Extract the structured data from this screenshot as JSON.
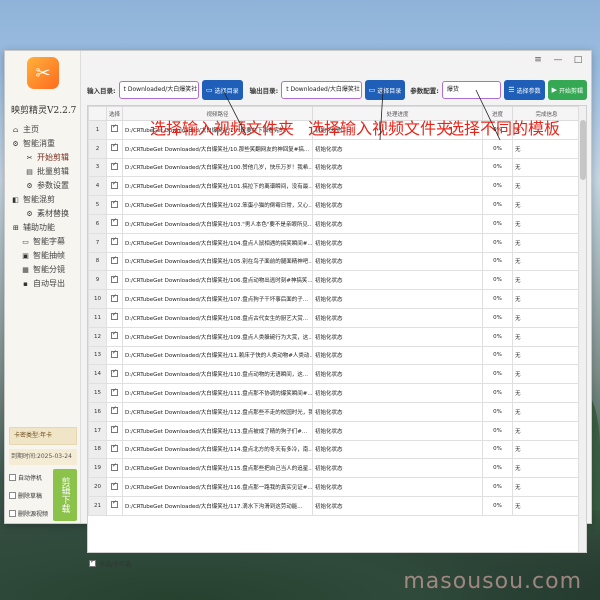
{
  "app": {
    "title": "映剪精灵V2.2.7"
  },
  "window_controls": [
    "≡",
    "—",
    "□"
  ],
  "sidebar": {
    "items": [
      {
        "label": "主页",
        "icon": "home-icon",
        "glyph": "⌂",
        "level": 0
      },
      {
        "label": "智能消重",
        "icon": "gear-icon",
        "glyph": "⚙",
        "level": 0
      },
      {
        "label": "开始剪辑",
        "icon": "scissors-icon",
        "glyph": "✂",
        "level": 1
      },
      {
        "label": "批量剪辑",
        "icon": "batch-icon",
        "glyph": "▤",
        "level": 1
      },
      {
        "label": "参数设置",
        "icon": "settings-icon",
        "glyph": "⚙",
        "level": 1
      },
      {
        "label": "智能混剪",
        "icon": "mix-icon",
        "glyph": "◧",
        "level": 0
      },
      {
        "label": "素材替换",
        "icon": "replace-icon",
        "glyph": "⚙",
        "level": 1
      },
      {
        "label": "辅助功能",
        "icon": "tools-icon",
        "glyph": "⊞",
        "level": 0
      },
      {
        "label": "智能字幕",
        "icon": "subtitle-icon",
        "glyph": "▭",
        "level": 2
      },
      {
        "label": "智能抽帧",
        "icon": "frame-icon",
        "glyph": "▣",
        "level": 2
      },
      {
        "label": "智能分镜",
        "icon": "storyboard-icon",
        "glyph": "▦",
        "level": 2
      },
      {
        "label": "自动导出",
        "icon": "export-icon",
        "glyph": "▪",
        "level": 2
      }
    ],
    "card_type": "卡密类型:年卡",
    "expire": "到期时间:2025-03-24",
    "options": [
      "自动停机",
      "删除草稿",
      "删除源视频"
    ],
    "cut_button": "剪辑下载"
  },
  "toolbar": {
    "input_label": "输入目录:",
    "input_value": "t Downloaded/大白爆笑社",
    "input_btn": "选择目录",
    "output_label": "输出目录:",
    "output_value": "t Downloaded/大白爆笑社",
    "output_btn": "选择目录",
    "param_label": "参数配置:",
    "param_value": "爆货",
    "param_btn": "选择参数",
    "start_btn": "开始剪辑"
  },
  "table": {
    "headers": [
      "",
      "选择",
      "视频路径",
      "处理进度",
      "进度",
      "完成信息"
    ],
    "rows": [
      {
        "n": "1",
        "path": "D:/CRTubeGet Downloaded/大白爆笑社/1.一定要在下面看完的...",
        "status": "初始化状态",
        "progress": "0%",
        "info": "无"
      },
      {
        "n": "2",
        "path": "D:/CRTubeGet Downloaded/大白爆笑社/10.那些笑翻网友的神回复#搞...",
        "status": "初始化状态",
        "progress": "0%",
        "info": "无"
      },
      {
        "n": "3",
        "path": "D:/CRTubeGet Downloaded/大白爆笑社/100.赞他几岁，快乐万岁！我希...",
        "status": "初始化状态",
        "progress": "0%",
        "info": "无"
      },
      {
        "n": "4",
        "path": "D:/CRTubeGet Downloaded/大白爆笑社/101.搞拉下的离谱瞬间，没有最...",
        "status": "初始化状态",
        "progress": "0%",
        "info": "无"
      },
      {
        "n": "5",
        "path": "D:/CRTubeGet Downloaded/大白爆笑社/102.笨蛋小猫的倒霉日常，又心...",
        "status": "初始化状态",
        "progress": "0%",
        "info": "无"
      },
      {
        "n": "6",
        "path": "D:/CRTubeGet Downloaded/大白爆笑社/103.\"男人本色\"要不是亲眼所见...",
        "status": "初始化状态",
        "progress": "0%",
        "info": "无"
      },
      {
        "n": "7",
        "path": "D:/CRTubeGet Downloaded/大白爆笑社/104.盘点人鼠相遇的搞笑瞬间#...",
        "status": "初始化状态",
        "progress": "0%",
        "info": "无"
      },
      {
        "n": "8",
        "path": "D:/CRTubeGet Downloaded/大白爆笑社/105.别在鸟子面前的腿面精神吧...",
        "status": "初始化状态",
        "progress": "0%",
        "info": "无"
      },
      {
        "n": "9",
        "path": "D:/CRTubeGet Downloaded/大白爆笑社/106.盘点动物出逃时刻#神搞笑...",
        "status": "初始化状态",
        "progress": "0%",
        "info": "无"
      },
      {
        "n": "10",
        "path": "D:/CRTubeGet Downloaded/大白爆笑社/107.盘点狗子干坏事后面的子...",
        "status": "初始化状态",
        "progress": "0%",
        "info": "无"
      },
      {
        "n": "11",
        "path": "D:/CRTubeGet Downloaded/大白爆笑社/108.盘点古代女生的厨艺大赏...",
        "status": "初始化状态",
        "progress": "0%",
        "info": "无"
      },
      {
        "n": "12",
        "path": "D:/CRTubeGet Downloaded/大白爆笑社/109.盘点人类躲碗行为大赏，这...",
        "status": "初始化状态",
        "progress": "0%",
        "info": "无"
      },
      {
        "n": "13",
        "path": "D:/CRTubeGet Downloaded/大白爆笑社/11.赖床子快的人类动物#人类动...",
        "status": "初始化状态",
        "progress": "0%",
        "info": "无"
      },
      {
        "n": "14",
        "path": "D:/CRTubeGet Downloaded/大白爆笑社/110.盘点动物的无语瞬间，这...",
        "status": "初始化状态",
        "progress": "0%",
        "info": "无"
      },
      {
        "n": "15",
        "path": "D:/CRTubeGet Downloaded/大白爆笑社/111.盘点那不协调的爆笑瞬间#...",
        "status": "初始化状态",
        "progress": "0%",
        "info": "无"
      },
      {
        "n": "16",
        "path": "D:/CRTubeGet Downloaded/大白爆笑社/112.盘点那些不走的校园时光，我...",
        "status": "初始化状态",
        "progress": "0%",
        "info": "无"
      },
      {
        "n": "17",
        "path": "D:/CRTubeGet Downloaded/大白爆笑社/113.盘点被成了精的狗子们#...",
        "status": "初始化状态",
        "progress": "0%",
        "info": "无"
      },
      {
        "n": "18",
        "path": "D:/CRTubeGet Downloaded/大白爆笑社/114.盘点北方的冬天有多冷，南...",
        "status": "初始化状态",
        "progress": "0%",
        "info": "无"
      },
      {
        "n": "19",
        "path": "D:/CRTubeGet Downloaded/大白爆笑社/115.盘点那些把自己当人的追星...",
        "status": "初始化状态",
        "progress": "0%",
        "info": "无"
      },
      {
        "n": "20",
        "path": "D:/CRTubeGet Downloaded/大白爆笑社/116.盘点那一路我的真实见证#...",
        "status": "初始化状态",
        "progress": "0%",
        "info": "无"
      },
      {
        "n": "21",
        "path": "D:/CRTubeGet Downloaded/大白爆笑社/117.滴水下沟滑到这劳动能...",
        "status": "初始化状态",
        "progress": "0%",
        "info": "无"
      }
    ]
  },
  "select_all": "全选/全不选",
  "annotations": {
    "a1": "选择输入视频文件夹",
    "a2": "选择输入视频文件夹",
    "a3": "选择不同的模板"
  },
  "watermark": "masousou.com",
  "colors": {
    "annotation": "#e8251a",
    "primary_btn": "#1f5fb8",
    "start_btn": "#34a853",
    "cut_btn": "#8bc34a"
  }
}
